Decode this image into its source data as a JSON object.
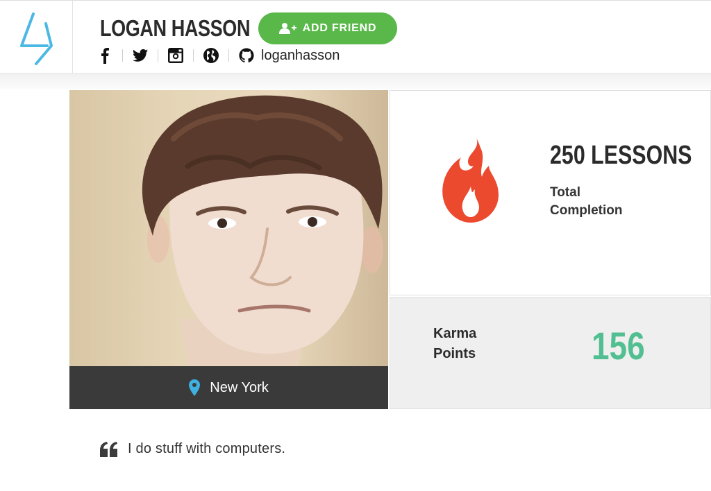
{
  "header": {
    "user_name": "LOGAN HASSON",
    "add_friend_label": "ADD FRIEND",
    "github_handle": "loganhasson",
    "social_icons": [
      "facebook-icon",
      "twitter-icon",
      "instagram-icon",
      "globe-icon",
      "github-icon"
    ]
  },
  "profile": {
    "location": "New York",
    "bio": "I do stuff with computers."
  },
  "stats": {
    "lessons_count": "250 LESSONS",
    "lessons_label": "Total Completion",
    "karma_label": "Karma Points",
    "karma_value": "156"
  },
  "colors": {
    "brand_blue": "#4cb8e4",
    "add_friend_green": "#5ab84a",
    "flame_red": "#ec4a2f",
    "karma_green": "#52bf92",
    "location_bar": "#3a3a3a"
  }
}
